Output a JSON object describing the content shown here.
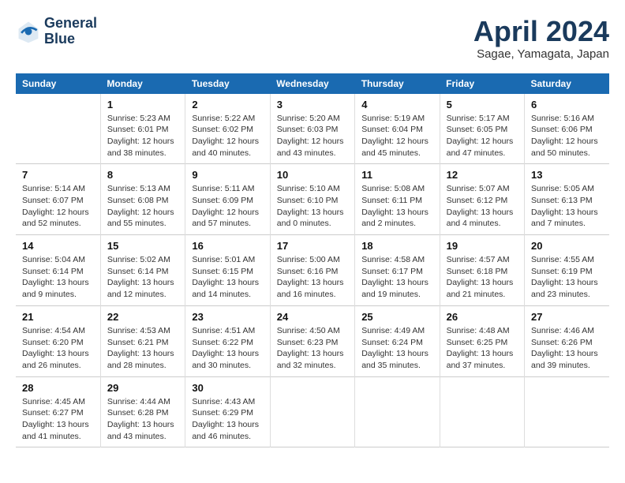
{
  "header": {
    "logo_line1": "General",
    "logo_line2": "Blue",
    "month": "April 2024",
    "location": "Sagae, Yamagata, Japan"
  },
  "weekdays": [
    "Sunday",
    "Monday",
    "Tuesday",
    "Wednesday",
    "Thursday",
    "Friday",
    "Saturday"
  ],
  "weeks": [
    [
      {
        "day": "",
        "info": ""
      },
      {
        "day": "1",
        "info": "Sunrise: 5:23 AM\nSunset: 6:01 PM\nDaylight: 12 hours and 38 minutes."
      },
      {
        "day": "2",
        "info": "Sunrise: 5:22 AM\nSunset: 6:02 PM\nDaylight: 12 hours and 40 minutes."
      },
      {
        "day": "3",
        "info": "Sunrise: 5:20 AM\nSunset: 6:03 PM\nDaylight: 12 hours and 43 minutes."
      },
      {
        "day": "4",
        "info": "Sunrise: 5:19 AM\nSunset: 6:04 PM\nDaylight: 12 hours and 45 minutes."
      },
      {
        "day": "5",
        "info": "Sunrise: 5:17 AM\nSunset: 6:05 PM\nDaylight: 12 hours and 47 minutes."
      },
      {
        "day": "6",
        "info": "Sunrise: 5:16 AM\nSunset: 6:06 PM\nDaylight: 12 hours and 50 minutes."
      }
    ],
    [
      {
        "day": "7",
        "info": "Sunrise: 5:14 AM\nSunset: 6:07 PM\nDaylight: 12 hours and 52 minutes."
      },
      {
        "day": "8",
        "info": "Sunrise: 5:13 AM\nSunset: 6:08 PM\nDaylight: 12 hours and 55 minutes."
      },
      {
        "day": "9",
        "info": "Sunrise: 5:11 AM\nSunset: 6:09 PM\nDaylight: 12 hours and 57 minutes."
      },
      {
        "day": "10",
        "info": "Sunrise: 5:10 AM\nSunset: 6:10 PM\nDaylight: 13 hours and 0 minutes."
      },
      {
        "day": "11",
        "info": "Sunrise: 5:08 AM\nSunset: 6:11 PM\nDaylight: 13 hours and 2 minutes."
      },
      {
        "day": "12",
        "info": "Sunrise: 5:07 AM\nSunset: 6:12 PM\nDaylight: 13 hours and 4 minutes."
      },
      {
        "day": "13",
        "info": "Sunrise: 5:05 AM\nSunset: 6:13 PM\nDaylight: 13 hours and 7 minutes."
      }
    ],
    [
      {
        "day": "14",
        "info": "Sunrise: 5:04 AM\nSunset: 6:14 PM\nDaylight: 13 hours and 9 minutes."
      },
      {
        "day": "15",
        "info": "Sunrise: 5:02 AM\nSunset: 6:14 PM\nDaylight: 13 hours and 12 minutes."
      },
      {
        "day": "16",
        "info": "Sunrise: 5:01 AM\nSunset: 6:15 PM\nDaylight: 13 hours and 14 minutes."
      },
      {
        "day": "17",
        "info": "Sunrise: 5:00 AM\nSunset: 6:16 PM\nDaylight: 13 hours and 16 minutes."
      },
      {
        "day": "18",
        "info": "Sunrise: 4:58 AM\nSunset: 6:17 PM\nDaylight: 13 hours and 19 minutes."
      },
      {
        "day": "19",
        "info": "Sunrise: 4:57 AM\nSunset: 6:18 PM\nDaylight: 13 hours and 21 minutes."
      },
      {
        "day": "20",
        "info": "Sunrise: 4:55 AM\nSunset: 6:19 PM\nDaylight: 13 hours and 23 minutes."
      }
    ],
    [
      {
        "day": "21",
        "info": "Sunrise: 4:54 AM\nSunset: 6:20 PM\nDaylight: 13 hours and 26 minutes."
      },
      {
        "day": "22",
        "info": "Sunrise: 4:53 AM\nSunset: 6:21 PM\nDaylight: 13 hours and 28 minutes."
      },
      {
        "day": "23",
        "info": "Sunrise: 4:51 AM\nSunset: 6:22 PM\nDaylight: 13 hours and 30 minutes."
      },
      {
        "day": "24",
        "info": "Sunrise: 4:50 AM\nSunset: 6:23 PM\nDaylight: 13 hours and 32 minutes."
      },
      {
        "day": "25",
        "info": "Sunrise: 4:49 AM\nSunset: 6:24 PM\nDaylight: 13 hours and 35 minutes."
      },
      {
        "day": "26",
        "info": "Sunrise: 4:48 AM\nSunset: 6:25 PM\nDaylight: 13 hours and 37 minutes."
      },
      {
        "day": "27",
        "info": "Sunrise: 4:46 AM\nSunset: 6:26 PM\nDaylight: 13 hours and 39 minutes."
      }
    ],
    [
      {
        "day": "28",
        "info": "Sunrise: 4:45 AM\nSunset: 6:27 PM\nDaylight: 13 hours and 41 minutes."
      },
      {
        "day": "29",
        "info": "Sunrise: 4:44 AM\nSunset: 6:28 PM\nDaylight: 13 hours and 43 minutes."
      },
      {
        "day": "30",
        "info": "Sunrise: 4:43 AM\nSunset: 6:29 PM\nDaylight: 13 hours and 46 minutes."
      },
      {
        "day": "",
        "info": ""
      },
      {
        "day": "",
        "info": ""
      },
      {
        "day": "",
        "info": ""
      },
      {
        "day": "",
        "info": ""
      }
    ]
  ]
}
